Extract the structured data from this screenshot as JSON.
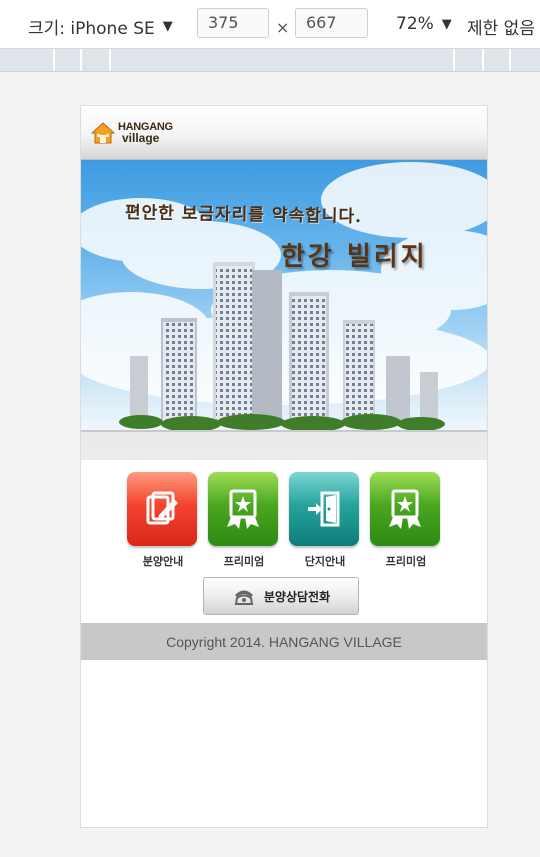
{
  "devtools": {
    "device_label": "크기: iPhone SE",
    "device_caret": "▼",
    "width_value": "375",
    "times_sign": "×",
    "height_value": "667",
    "zoom_label": "72%",
    "zoom_caret": "▼",
    "throttle_label": "제한 없음"
  },
  "site": {
    "logo": {
      "brand": "HANGANG",
      "sub": "village"
    },
    "hero": {
      "line1": "편안한 보금자리를 약속합니다.",
      "line2": "한강 빌리지"
    },
    "menu": [
      {
        "label": "분양안내",
        "icon": "edit-document-icon",
        "color": "#f4432d"
      },
      {
        "label": "프리미엄",
        "icon": "award-ribbon-icon",
        "color": "#4aa620"
      },
      {
        "label": "단지안내",
        "icon": "enter-door-icon",
        "color": "#27a39d"
      },
      {
        "label": "프리미엄",
        "icon": "award-ribbon-icon",
        "color": "#4aa620"
      }
    ],
    "call_button": {
      "label": "분양상담전화",
      "icon": "telephone-icon"
    },
    "footer": {
      "copyright": "Copyright 2014. HANGANG VILLAGE"
    }
  }
}
